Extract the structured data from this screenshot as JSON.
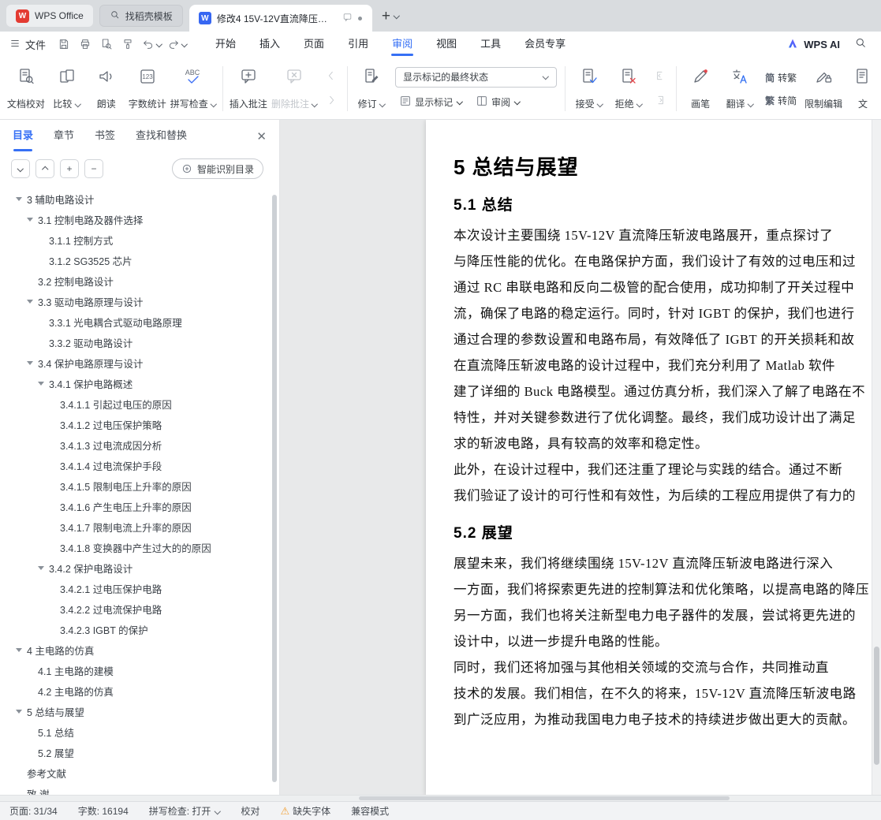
{
  "accent": "#3670f5",
  "tabbar": {
    "home_tab": "WPS Office",
    "template_tab": "找稻壳模板",
    "doc_tab": "修改4 15V-12V直流降压斩波...",
    "logo_letter": "W",
    "doc_icon_letter": "W",
    "new_tab": "+"
  },
  "menubar": {
    "file": "文件",
    "items": [
      {
        "label": "开始"
      },
      {
        "label": "插入"
      },
      {
        "label": "页面"
      },
      {
        "label": "引用"
      },
      {
        "label": "审阅",
        "active": true
      },
      {
        "label": "视图"
      },
      {
        "label": "工具"
      },
      {
        "label": "会员专享"
      }
    ],
    "wps_ai": "WPS AI"
  },
  "ribbon": {
    "proofread": "文档校对",
    "compare": "比较",
    "read_aloud": "朗读",
    "word_count": "字数统计",
    "spell_check": "拼写检查",
    "insert_comment": "插入批注",
    "delete_comment": "删除批注",
    "track_changes": "修订",
    "markup_state": "显示标记的最终状态",
    "show_markup": "显示标记",
    "review_pane": "审阅",
    "accept": "接受",
    "reject": "拒绝",
    "pen": "画笔",
    "translate": "翻译",
    "to_traditional": "转繁",
    "to_simplified": "转简",
    "simplified_glyph": "简",
    "traditional_glyph": "繁",
    "restrict_edit": "限制编辑",
    "clipped_button": "文"
  },
  "sidebar": {
    "tabs": [
      {
        "label": "目录",
        "active": true
      },
      {
        "label": "章节"
      },
      {
        "label": "书签"
      },
      {
        "label": "查找和替换"
      }
    ],
    "smart_toc_button": "智能识别目录",
    "toc": [
      {
        "label": "3 辅助电路设计",
        "level": 1,
        "arrow": true
      },
      {
        "label": "3.1 控制电路及器件选择",
        "level": 2,
        "arrow": true
      },
      {
        "label": "3.1.1 控制方式",
        "level": 3
      },
      {
        "label": "3.1.2 SG3525 芯片",
        "level": 3
      },
      {
        "label": "3.2 控制电路设计",
        "level": 2
      },
      {
        "label": "3.3 驱动电路原理与设计",
        "level": 2,
        "arrow": true
      },
      {
        "label": "3.3.1 光电耦合式驱动电路原理",
        "level": 3
      },
      {
        "label": "3.3.2 驱动电路设计",
        "level": 3
      },
      {
        "label": "3.4 保护电路原理与设计",
        "level": 2,
        "arrow": true
      },
      {
        "label": "3.4.1 保护电路概述",
        "level": 3,
        "arrow": true
      },
      {
        "label": "3.4.1.1 引起过电压的原因",
        "level": 4
      },
      {
        "label": "3.4.1.2 过电压保护策略",
        "level": 4
      },
      {
        "label": "3.4.1.3 过电流成因分析",
        "level": 4
      },
      {
        "label": "3.4.1.4 过电流保护手段",
        "level": 4
      },
      {
        "label": "3.4.1.5 限制电压上升率的原因",
        "level": 4
      },
      {
        "label": "3.4.1.6 产生电压上升率的原因",
        "level": 4
      },
      {
        "label": "3.4.1.7 限制电流上升率的原因",
        "level": 4
      },
      {
        "label": "3.4.1.8 变换器中产生过大的的原因",
        "level": 4
      },
      {
        "label": "3.4.2 保护电路设计",
        "level": 3,
        "arrow": true
      },
      {
        "label": "3.4.2.1 过电压保护电路",
        "level": 4
      },
      {
        "label": "3.4.2.2 过电流保护电路",
        "level": 4
      },
      {
        "label": "3.4.2.3 IGBT 的保护",
        "level": 4
      },
      {
        "label": "4 主电路的仿真",
        "level": 1,
        "arrow": true
      },
      {
        "label": "4.1 主电路的建模",
        "level": 2
      },
      {
        "label": "4.2 主电路的仿真",
        "level": 2
      },
      {
        "label": "5 总结与展望",
        "level": 1,
        "arrow": true
      },
      {
        "label": "5.1 总结",
        "level": 2
      },
      {
        "label": "5.2 展望",
        "level": 2
      },
      {
        "label": "参考文献",
        "level": 1
      },
      {
        "label": "致 谢",
        "level": 1
      }
    ]
  },
  "document": {
    "chapter_heading": "5 总结与展望",
    "sections": [
      {
        "heading": "5.1 总结",
        "paragraphs": [
          [
            "本次设计主要围绕 15V-12V 直流降压斩波电路展开，重点探讨了",
            "与降压性能的优化。在电路保护方面，我们设计了有效的过电压和过",
            "通过 RC 串联电路和反向二极管的配合使用，成功抑制了开关过程中",
            "流，确保了电路的稳定运行。同时，针对 IGBT 的保护，我们也进行",
            "通过合理的参数设置和电路布局，有效降低了 IGBT 的开关损耗和故"
          ],
          [
            "在直流降压斩波电路的设计过程中，我们充分利用了 Matlab 软件",
            "建了详细的 Buck 电路模型。通过仿真分析，我们深入了解了电路在不",
            "特性，并对关键参数进行了优化调整。最终，我们成功设计出了满足",
            "求的斩波电路，具有较高的效率和稳定性。"
          ],
          [
            "此外，在设计过程中，我们还注重了理论与实践的结合。通过不断",
            "我们验证了设计的可行性和有效性，为后续的工程应用提供了有力的"
          ]
        ]
      },
      {
        "heading": "5.2 展望",
        "paragraphs": [
          [
            "展望未来，我们将继续围绕 15V-12V 直流降压斩波电路进行深入",
            "一方面，我们将探索更先进的控制算法和优化策略，以提高电路的降压",
            "另一方面，我们也将关注新型电力电子器件的发展，尝试将更先进的",
            "设计中，以进一步提升电路的性能。"
          ],
          [
            "同时，我们还将加强与其他相关领域的交流与合作，共同推动直",
            "技术的发展。我们相信，在不久的将来，15V-12V 直流降压斩波电路",
            "到广泛应用，为推动我国电力电子技术的持续进步做出更大的贡献。"
          ]
        ]
      }
    ]
  },
  "statusbar": {
    "page_indicator": "页面: 31/34",
    "word_count": "字数: 16194",
    "spell_check": "拼写检查: 打开",
    "proofread": "校对",
    "missing_font": "缺失字体",
    "compat_mode": "兼容模式"
  }
}
